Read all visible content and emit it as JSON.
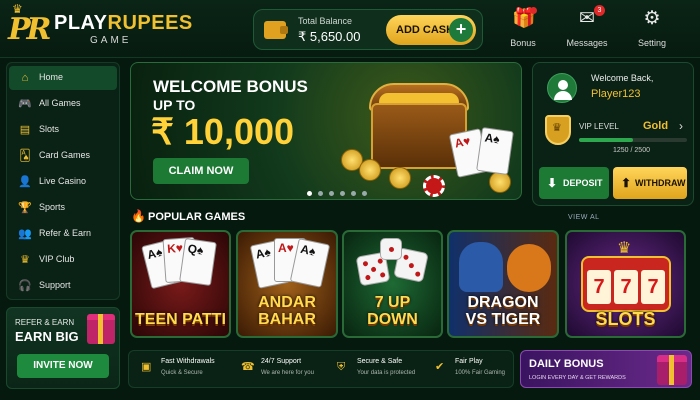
{
  "logo": {
    "mark": "PR",
    "name_a": "PLAY",
    "name_b": "RUPEES",
    "sub": "GAME"
  },
  "balance": {
    "label": "Total Balance",
    "value": "₹ 5,650.00",
    "add_cash": "ADD CASH"
  },
  "header_actions": [
    {
      "label": "Bonus",
      "icon": "gift-icon",
      "glyph": "🎁"
    },
    {
      "label": "Messages",
      "icon": "envelope-icon",
      "glyph": "✉",
      "badge": "3"
    },
    {
      "label": "Setting",
      "icon": "gear-icon",
      "glyph": "⚙"
    }
  ],
  "sidebar": {
    "items": [
      {
        "label": "Home",
        "icon": "home-icon",
        "glyph": "⌂",
        "active": true
      },
      {
        "label": "All Games",
        "icon": "gamepad-icon",
        "glyph": "🎮"
      },
      {
        "label": "Slots",
        "icon": "slots-icon",
        "glyph": "▤"
      },
      {
        "label": "Card Games",
        "icon": "cards-icon",
        "glyph": "🂡"
      },
      {
        "label": "Live Casino",
        "icon": "dealer-icon",
        "glyph": "👤"
      },
      {
        "label": "Sports",
        "icon": "trophy-icon",
        "glyph": "🏆"
      },
      {
        "label": "Refer & Earn",
        "icon": "users-icon",
        "glyph": "👥"
      },
      {
        "label": "VIP Club",
        "icon": "crown-icon",
        "glyph": "♛"
      },
      {
        "label": "Support",
        "icon": "headset-icon",
        "glyph": "🎧"
      }
    ]
  },
  "refer": {
    "line1": "REFER & EARN",
    "line2": "EARN BIG",
    "invite": "INVITE NOW"
  },
  "hero": {
    "line1": "WELCOME BONUS",
    "line2": "UP TO",
    "amount": "₹ 10,000",
    "cta": "CLAIM NOW",
    "slides": 6,
    "active_slide": 0
  },
  "user": {
    "welcome": "Welcome Back,",
    "username": "Player123",
    "vip_label": "VIP LEVEL",
    "vip_level": "Gold",
    "progress_text": "1250 / 2500",
    "progress": 0.5,
    "deposit": "DEPOSIT",
    "withdraw": "WITHDRAW"
  },
  "popular": {
    "title": "POPULAR GAMES",
    "view_all": "VIEW AL",
    "games": [
      {
        "name": "TEEN PATTI"
      },
      {
        "name": "ANDAR BAHAR"
      },
      {
        "name": "7 UP DOWN"
      },
      {
        "name": "DRAGON VS TIGER"
      },
      {
        "name": "SLOTS"
      }
    ]
  },
  "features": [
    {
      "title": "Fast Withdrawals",
      "sub": "Quick & Secure",
      "icon": "wallet-icon",
      "glyph": "▣"
    },
    {
      "title": "24/7 Support",
      "sub": "We are here for you",
      "icon": "headset-icon",
      "glyph": "☎"
    },
    {
      "title": "Secure & Safe",
      "sub": "Your data is protected",
      "icon": "shield-icon",
      "glyph": "⛨"
    },
    {
      "title": "Fair Play",
      "sub": "100% Fair Gaming",
      "icon": "shield-check-icon",
      "glyph": "✔"
    }
  ],
  "daily": {
    "title": "DAILY BONUS",
    "sub": "LOGIN EVERY DAY & GET REWARDS"
  },
  "colors": {
    "brand_gold": "#f0c030",
    "brand_green": "#1c7a34",
    "background": "#06190f"
  }
}
